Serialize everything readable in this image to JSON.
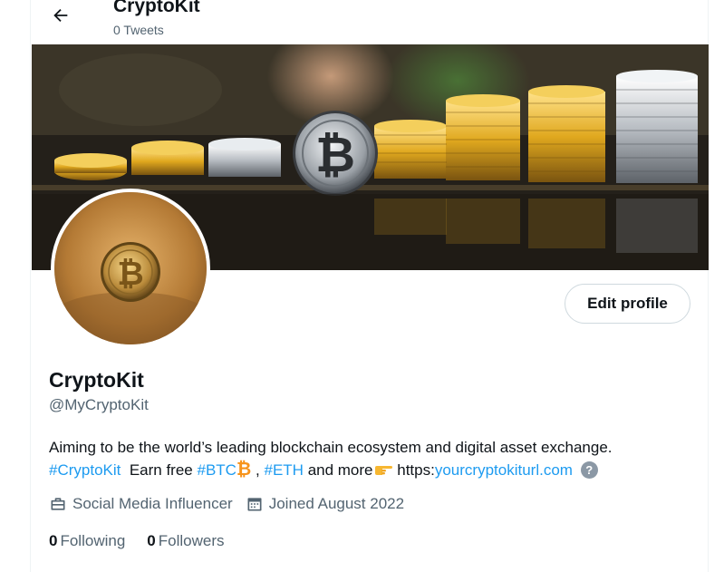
{
  "header": {
    "title": "CryptoKit",
    "tweet_count": "0 Tweets"
  },
  "profile": {
    "display_name": "CryptoKit",
    "handle": "@MyCryptoKit",
    "edit_button": "Edit profile",
    "bio": {
      "line1": "Aiming to be the world’s leading blockchain ecosystem and digital asset exchange.",
      "hashtag_cryptokit": "#CryptoKit",
      "text_earn": "Earn free",
      "hashtag_btc": "#BTC",
      "btc_symbol": "₿",
      "comma": ",",
      "hashtag_eth": "#ETH",
      "text_more": "and more",
      "url_prefix": "https:",
      "url_link": "yourcryptokiturl.com",
      "help": "?"
    },
    "category": "Social Media Influencer",
    "joined": "Joined August 2022",
    "following_count": "0",
    "following_label": "Following",
    "followers_count": "0",
    "followers_label": "Followers"
  },
  "icons": {
    "back": "arrow-left-icon",
    "category": "briefcase-icon",
    "joined": "calendar-icon",
    "help": "question-circle-icon",
    "pointing": "pointing-hand-emoji"
  },
  "colors": {
    "link": "#1d9bf0",
    "secondary_text": "#536471",
    "primary_text": "#0f1419",
    "btc_orange": "#f7931a"
  }
}
